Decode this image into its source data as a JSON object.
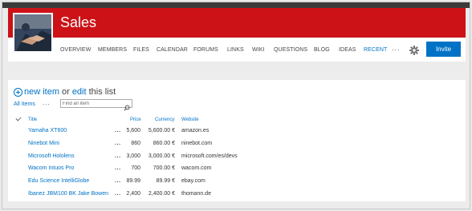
{
  "site": {
    "title": "Sales",
    "invite_label": "Invite",
    "nav": [
      {
        "label": "OVERVIEW",
        "active": false
      },
      {
        "label": "MEMBERS",
        "active": false
      },
      {
        "label": "FILES",
        "active": false
      },
      {
        "label": "CALENDAR",
        "active": false
      },
      {
        "label": "FORUMS",
        "active": false
      },
      {
        "label": "LINKS",
        "active": false
      },
      {
        "label": "WIKI",
        "active": false
      },
      {
        "label": "QUESTIONS",
        "active": false
      },
      {
        "label": "BLOG",
        "active": false
      },
      {
        "label": "IDEAS",
        "active": false
      },
      {
        "label": "RECENT",
        "active": true
      }
    ],
    "nav_more": "...",
    "icons": {
      "settings": "gear-icon",
      "new_item": "plus-circle-icon",
      "search": "search-icon"
    },
    "colors": {
      "brand": "#cc1217",
      "accent": "#0072c6"
    }
  },
  "list": {
    "new_item_label": "new item",
    "or_label": "or",
    "edit_label": "edit",
    "this_list_label": "this list",
    "view_label": "All Items",
    "view_more": "...",
    "search_placeholder": "Find an item",
    "columns": {
      "title": "Title",
      "price": "Price",
      "currency": "Currency",
      "website": "Website"
    },
    "row_menu": "...",
    "rows": [
      {
        "title": "Yamaha XT600",
        "price": "5,600",
        "currency": "5,600.00 €",
        "website": "amazon.es"
      },
      {
        "title": "Ninebot Mini",
        "price": "860",
        "currency": "860.00 €",
        "website": "ninebot.com"
      },
      {
        "title": "Microsoft Hololens",
        "price": "3,000",
        "currency": "3,000.00 €",
        "website": "microsoft.com/es/devs"
      },
      {
        "title": "Wacom Intuos Pro",
        "price": "700",
        "currency": "700.00 €",
        "website": "wacom.com"
      },
      {
        "title": "Edu Science IntelliGlobe",
        "price": "89.99",
        "currency": "89.99 €",
        "website": "ebay.com"
      },
      {
        "title": "Ibanez JBM100 BK Jake Bowen",
        "price": "2,400",
        "currency": "2,400.00 €",
        "website": "thomann.de"
      }
    ]
  }
}
